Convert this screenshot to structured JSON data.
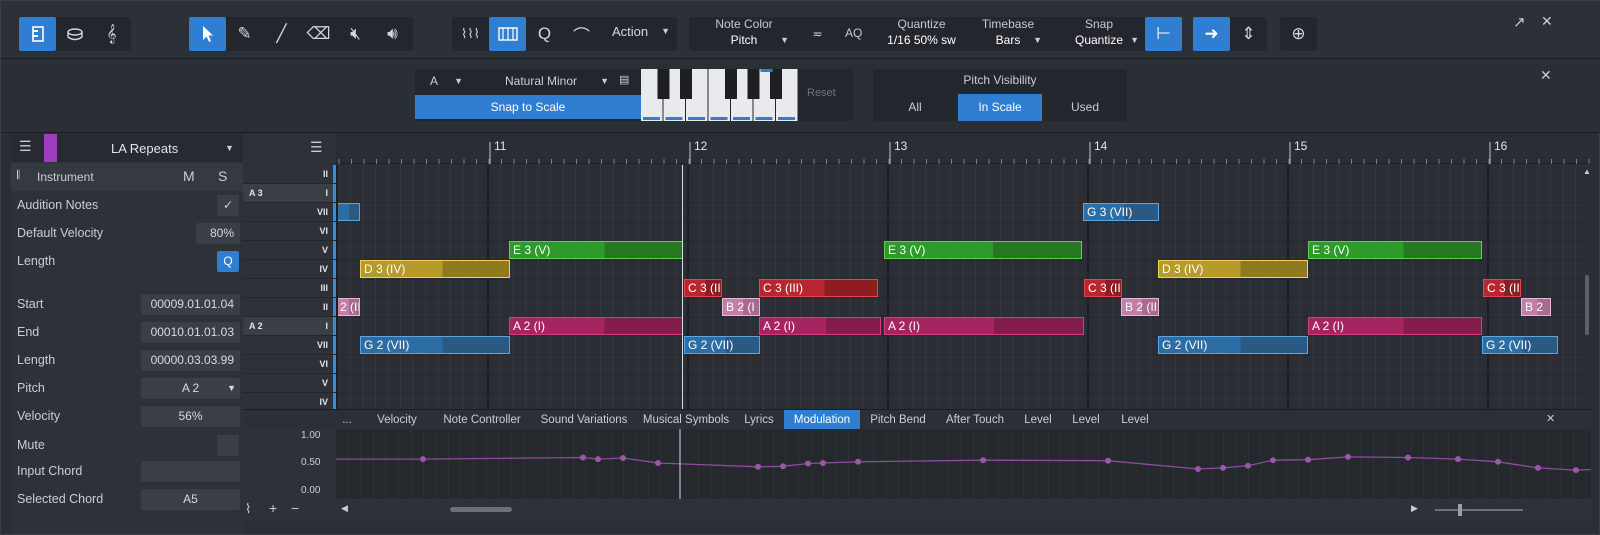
{
  "toolbar": {
    "action_label": "Action",
    "note_color": {
      "title": "Note Color",
      "value": "Pitch"
    },
    "aq_label": "AQ",
    "quantize": {
      "title": "Quantize",
      "value": "1/16 50% sw"
    },
    "timebase": {
      "title": "Timebase",
      "value": "Bars"
    },
    "snap": {
      "title": "Snap",
      "value": "Quantize"
    }
  },
  "scale": {
    "root": "A",
    "mode": "Natural Minor",
    "snap_label": "Snap to Scale",
    "reset_label": "Reset",
    "pitch_visibility": {
      "title": "Pitch Visibility",
      "options": [
        "All",
        "In Scale",
        "Used"
      ],
      "selected": "In Scale"
    }
  },
  "inspector": {
    "track_name": "LA Repeats",
    "instrument_label": "Instrument",
    "m_label": "M",
    "s_label": "S",
    "audition_label": "Audition Notes",
    "default_velocity_label": "Default Velocity",
    "default_velocity_value": "80%",
    "length_label": "Length",
    "length_q": "Q",
    "start_label": "Start",
    "start_value": "00009.01.01.04",
    "end_label": "End",
    "end_value": "00010.01.01.03",
    "length2_label": "Length",
    "length2_value": "00000.03.03.99",
    "pitch_label": "Pitch",
    "pitch_value": "A 2",
    "velocity_label": "Velocity",
    "velocity_value": "56%",
    "mute_label": "Mute",
    "input_chord_label": "Input Chord",
    "input_chord_value": "",
    "selected_chord_label": "Selected Chord",
    "selected_chord_value": "A5"
  },
  "ruler": {
    "bars": [
      "11",
      "12",
      "13",
      "14",
      "15",
      "16"
    ]
  },
  "keys": [
    {
      "roman": "II",
      "name": ""
    },
    {
      "roman": "I",
      "name": "A 3"
    },
    {
      "roman": "VII",
      "name": ""
    },
    {
      "roman": "VI",
      "name": ""
    },
    {
      "roman": "V",
      "name": ""
    },
    {
      "roman": "IV",
      "name": ""
    },
    {
      "roman": "III",
      "name": ""
    },
    {
      "roman": "II",
      "name": ""
    },
    {
      "roman": "I",
      "name": "A 2"
    },
    {
      "roman": "VII",
      "name": ""
    },
    {
      "roman": "VI",
      "name": ""
    },
    {
      "roman": "V",
      "name": ""
    },
    {
      "roman": "IV",
      "name": ""
    }
  ],
  "notes": [
    {
      "label": "",
      "color": "blue"
    },
    {
      "label": "G 3 (VII)",
      "color": "blue"
    },
    {
      "label": "E 3 (V)",
      "color": "green"
    },
    {
      "label": "E 3 (V)",
      "color": "green"
    },
    {
      "label": "E 3 (V)",
      "color": "green"
    },
    {
      "label": "D 3 (IV)",
      "color": "yellow"
    },
    {
      "label": "D 3 (IV)",
      "color": "yellow"
    },
    {
      "label": "C 3 (II",
      "color": "red"
    },
    {
      "label": "C 3 (III)",
      "color": "red"
    },
    {
      "label": "C 3 (II",
      "color": "red"
    },
    {
      "label": "C 3 (II",
      "color": "red"
    },
    {
      "label": "2 (II",
      "color": "pink"
    },
    {
      "label": "B 2 (I",
      "color": "pink"
    },
    {
      "label": "B 2 (II",
      "color": "pink"
    },
    {
      "label": "B 2",
      "color": "pink"
    },
    {
      "label": "A 2 (I)",
      "color": "magenta"
    },
    {
      "label": "A 2 (I)",
      "color": "magenta"
    },
    {
      "label": "A 2 (I)",
      "color": "magenta"
    },
    {
      "label": "A 2 (I)",
      "color": "magenta"
    },
    {
      "label": "G 2 (VII)",
      "color": "blue"
    },
    {
      "label": "G 2 (VII)",
      "color": "blue"
    },
    {
      "label": "G 2 (VII)",
      "color": "blue"
    },
    {
      "label": "G 2 (VII)",
      "color": "blue"
    }
  ],
  "note_colors": {
    "blue": "#2c6ea3",
    "green": "#2f9a2a",
    "yellow": "#b59b2a",
    "red": "#b8272f",
    "pink": "#c27fa8",
    "magenta": "#a52560"
  },
  "automation": {
    "more_label": "...",
    "tabs": [
      "Velocity",
      "Note Controller",
      "Sound Variations",
      "Musical Symbols",
      "Lyrics",
      "Modulation",
      "Pitch Bend",
      "After Touch",
      "Level",
      "Level",
      "Level"
    ],
    "active_tab": "Modulation",
    "y_labels": [
      "1.00",
      "0.50",
      "0.00"
    ],
    "curve_color": "#8c4d9a",
    "points": [
      0.58,
      0.58,
      0.61,
      0.58,
      0.6,
      0.51,
      0.44,
      0.45,
      0.5,
      0.51,
      0.53,
      0.56,
      0.55,
      0.4,
      0.42,
      0.46,
      0.56,
      0.57,
      0.62,
      0.61,
      0.58,
      0.53,
      0.42,
      0.38,
      0.39
    ]
  }
}
